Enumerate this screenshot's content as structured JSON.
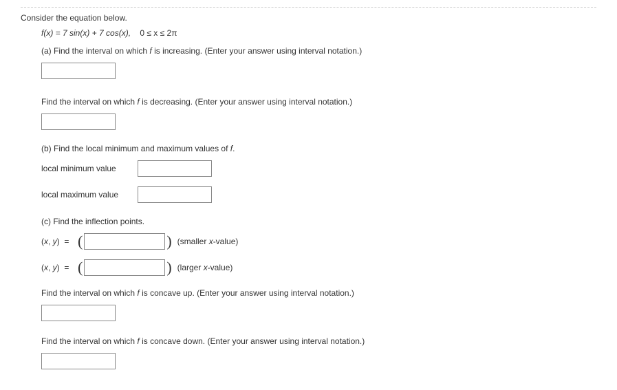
{
  "intro": "Consider the equation below.",
  "equation": {
    "lhs": "f(x) = 7 sin(x) + 7 cos(x),",
    "domain": "0 ≤ x ≤ 2π"
  },
  "parts": {
    "a": {
      "text1": "(a) Find the interval on which ",
      "text_f": "f",
      "text2": " is increasing. (Enter your answer using interval notation.)",
      "dec1": "Find the interval on which ",
      "dec_f": "f",
      "dec2": " is decreasing. (Enter your answer using interval notation.)"
    },
    "b": {
      "text": "(b) Find the local minimum and maximum values of ",
      "f": "f",
      "period": ".",
      "min_label": "local minimum value",
      "max_label": "local maximum value"
    },
    "c": {
      "text": "(c) Find the inflection points.",
      "xy": "(x, y)  =  ",
      "hint_small": "(smaller x-value)",
      "hint_large": "(larger x-value)",
      "concave_up1": "Find the interval on which ",
      "concave_up_f": "f",
      "concave_up2": " is concave up. (Enter your answer using interval notation.)",
      "concave_dn1": "Find the interval on which ",
      "concave_dn_f": "f",
      "concave_dn2": " is concave down. (Enter your answer using interval notation.)"
    }
  }
}
